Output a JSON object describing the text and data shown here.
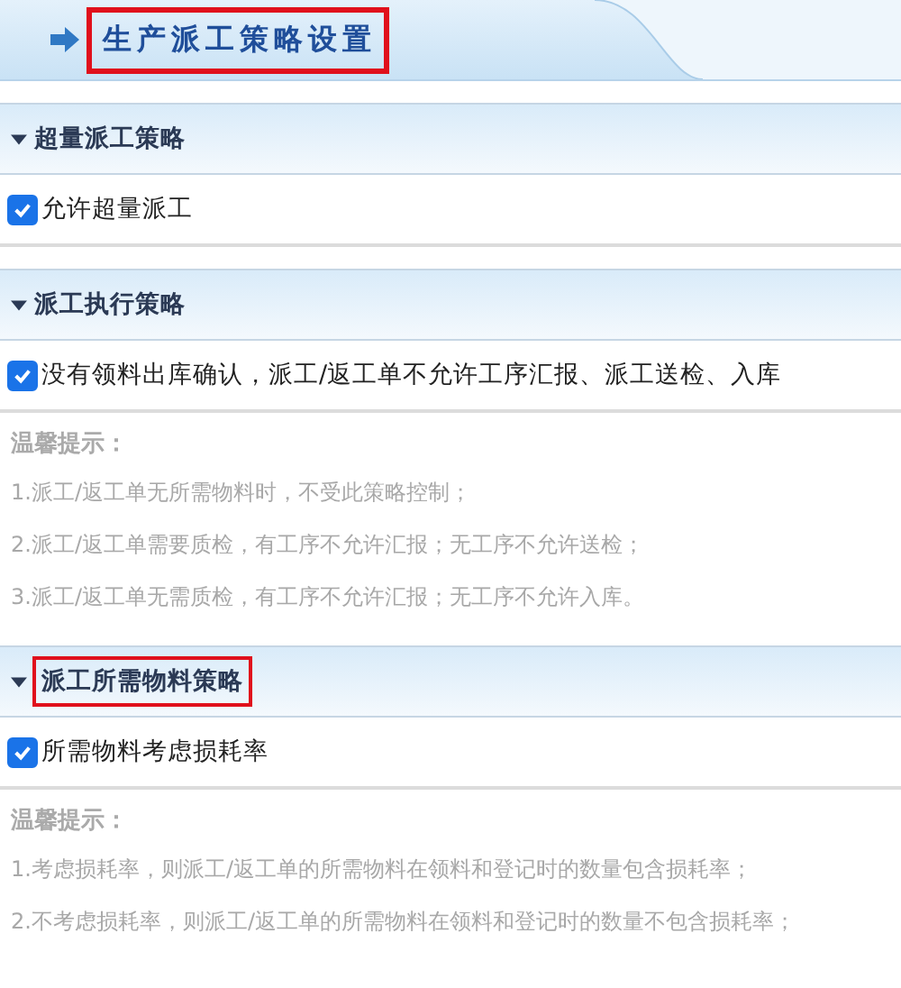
{
  "header": {
    "title": "生产派工策略设置",
    "highlighted": true
  },
  "sections": [
    {
      "title": "超量派工策略",
      "expanded": true,
      "highlighted": false,
      "options": [
        {
          "label": "允许超量派工",
          "checked": true
        }
      ]
    },
    {
      "title": "派工执行策略",
      "expanded": true,
      "highlighted": false,
      "options": [
        {
          "label": "没有领料出库确认，派工/返工单不允许工序汇报、派工送检、入库",
          "checked": true
        }
      ],
      "tips": {
        "heading": "温馨提示：",
        "items": [
          "1.派工/返工单无所需物料时，不受此策略控制；",
          "2.派工/返工单需要质检，有工序不允许汇报；无工序不允许送检；",
          "3.派工/返工单无需质检，有工序不允许汇报；无工序不允许入库。"
        ]
      }
    },
    {
      "title": "派工所需物料策略",
      "expanded": true,
      "highlighted": true,
      "options": [
        {
          "label": "所需物料考虑损耗率",
          "checked": true
        }
      ],
      "tips": {
        "heading": "温馨提示：",
        "items": [
          "1.考虑损耗率，则派工/返工单的所需物料在领料和登记时的数量包含损耗率；",
          "2.不考虑损耗率，则派工/返工单的所需物料在领料和登记时的数量不包含损耗率；"
        ]
      }
    }
  ]
}
